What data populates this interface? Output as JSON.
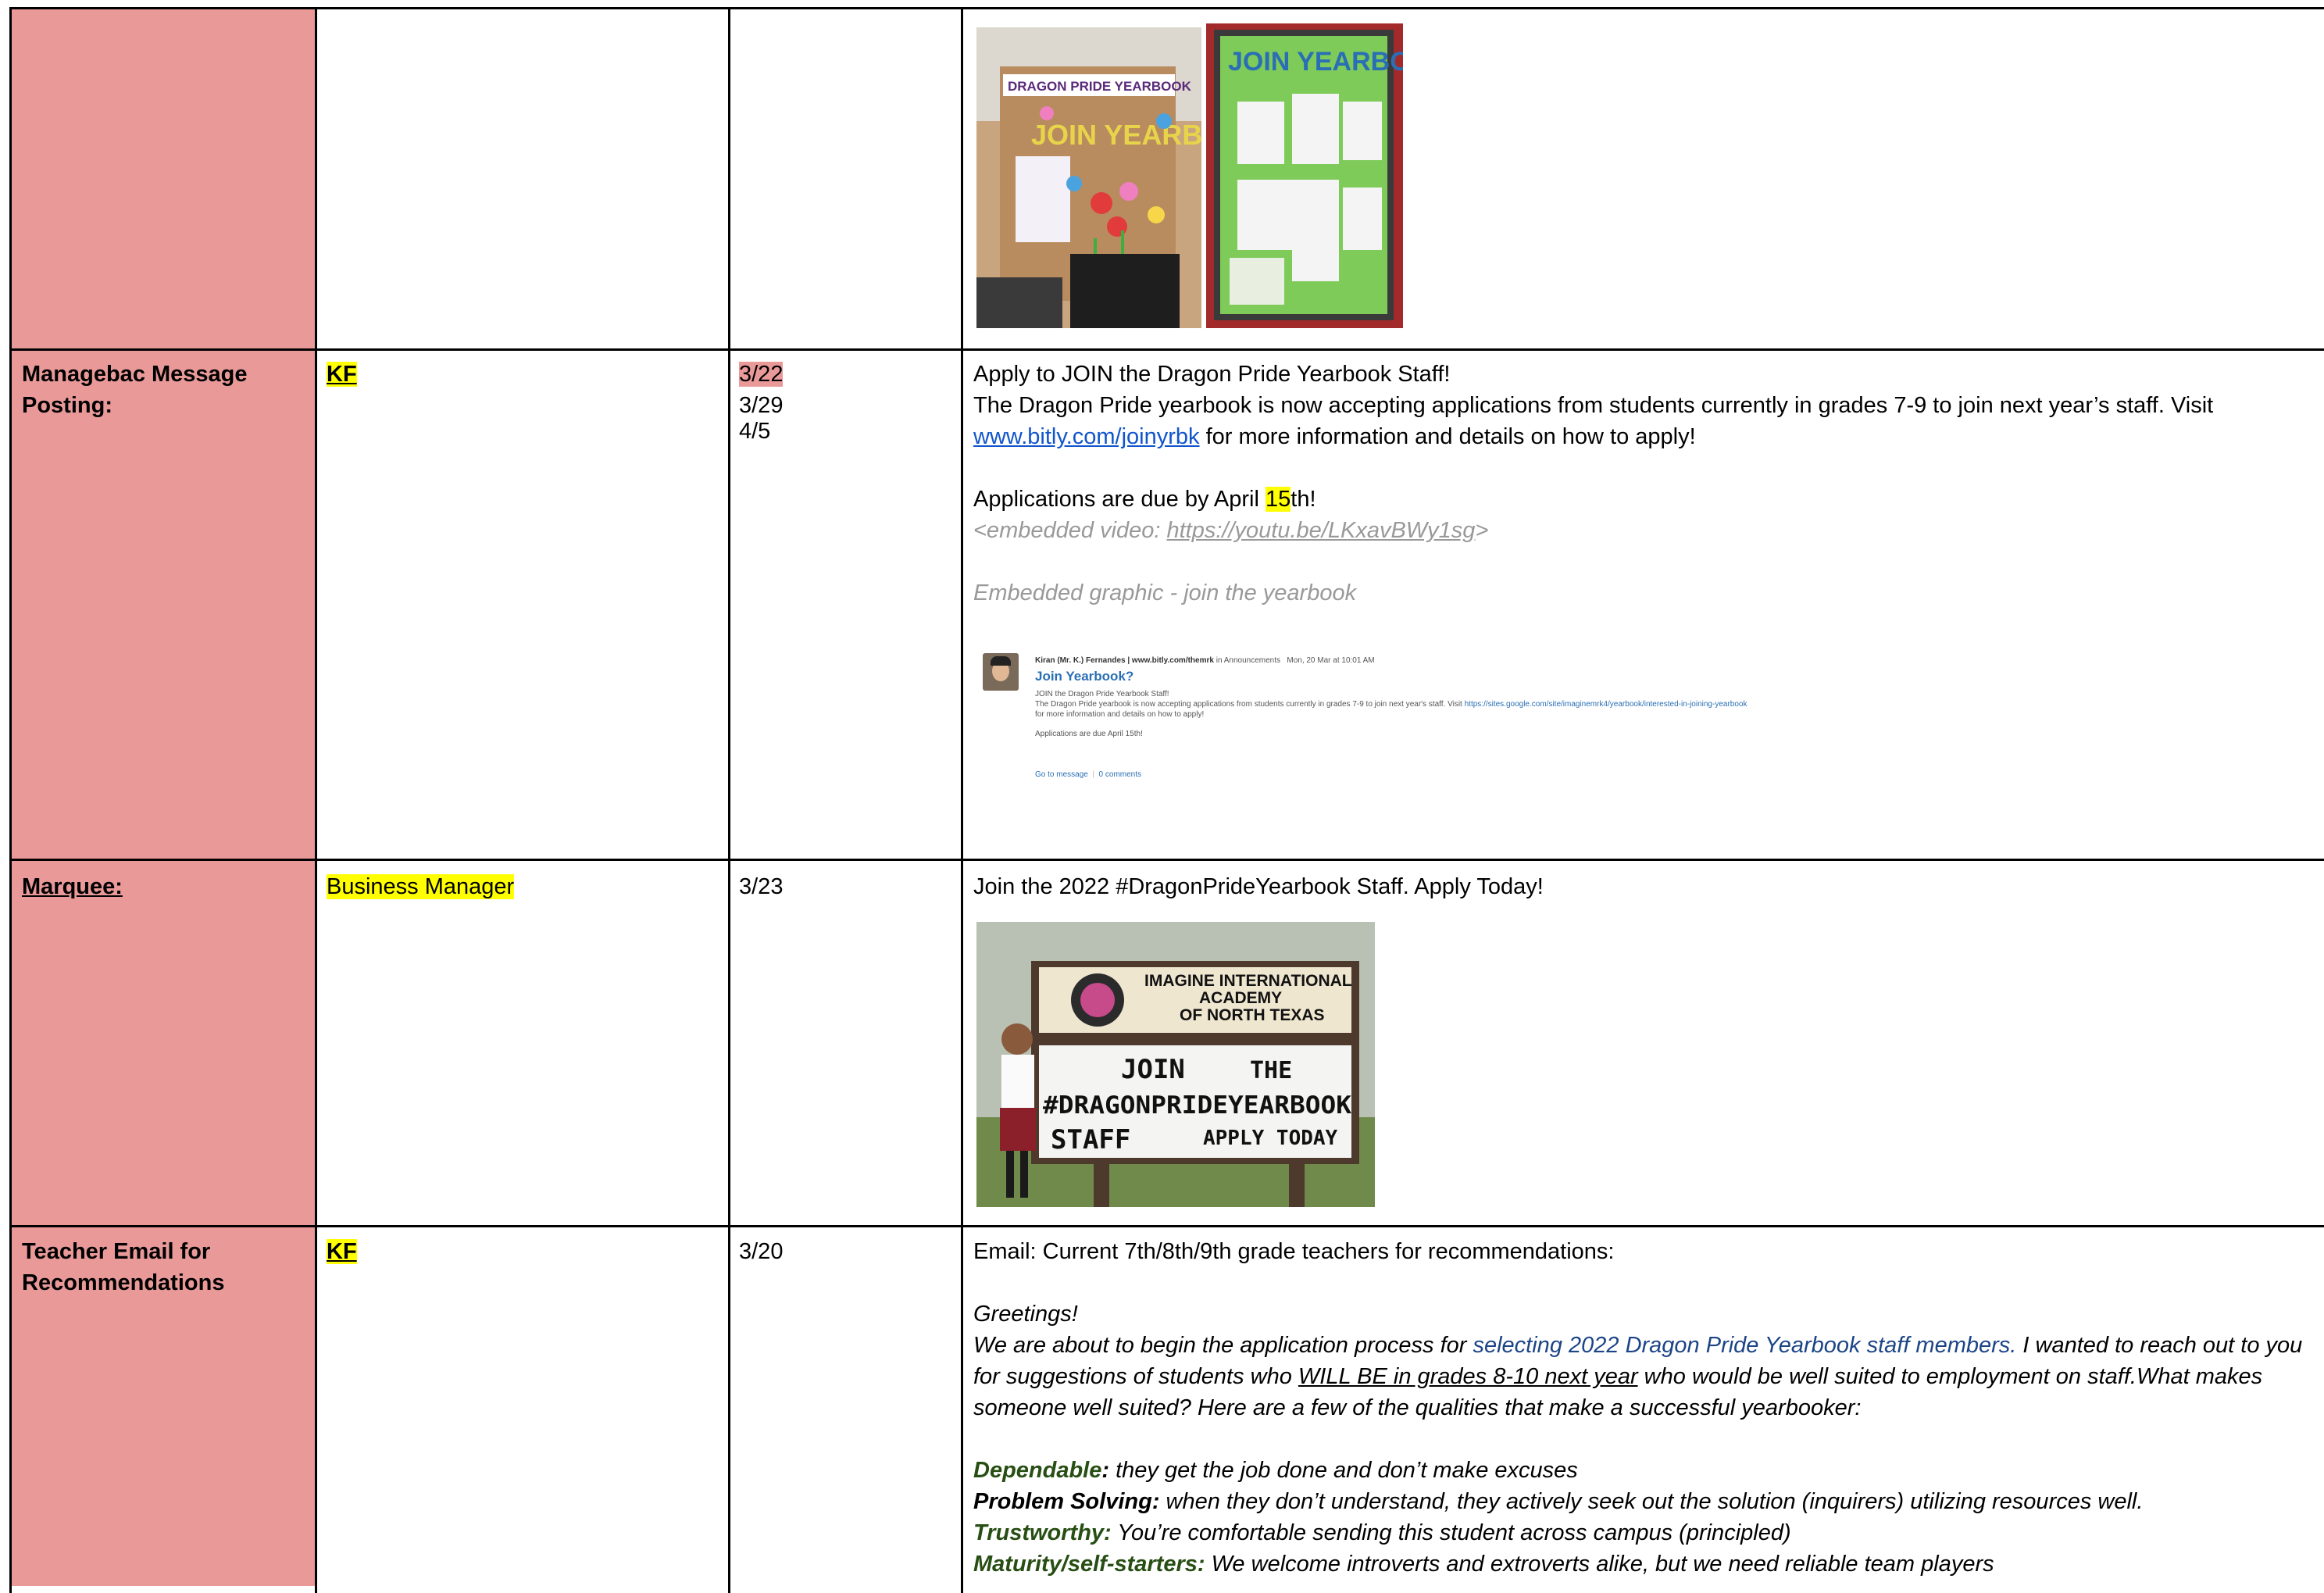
{
  "rows": {
    "r1": {
      "photo1": {
        "banner": "DRAGON PRIDE YEARBOOK",
        "letters": "JOIN YEARBOOK"
      },
      "photo2": {
        "title": "JOIN YEARBOOK"
      }
    },
    "managebac": {
      "title_line1": "Managebac Message",
      "title_line2": "Posting:",
      "person": "KF",
      "date1": "3/22",
      "date2": "3/29",
      "date3": "4/5",
      "line1": "Apply to JOIN the Dragon Pride Yearbook Staff!",
      "line2": "The Dragon Pride yearbook is now accepting applications from students currently in grades 7-9 to join next year’s staff. Visit",
      "link": "www.bitly.com/joinyrbk",
      "line3_rest": " for more information and details on how to apply!",
      "due_pre": "Applications are due by April ",
      "due_hl": "15",
      "due_post": "th!",
      "video_pre": "<embedded video: ",
      "video_link": "https://youtu.be/LKxavBWy1sg",
      "video_post": ">",
      "graphic": "Embedded graphic - join the yearbook",
      "shot": {
        "author": "Kiran (Mr. K.) Fernandes | www.bitly.com/themrk",
        "in": " in Announcements",
        "time": "Mon, 20 Mar at 10:01 AM",
        "title": "Join Yearbook?",
        "l1": "JOIN the Dragon Pride Yearbook Staff!",
        "l2": "The Dragon Pride yearbook is now accepting applications from students currently in grades 7-9 to join next year's staff. Visit",
        "l2link": "https://sites.google.com/site/imaginemrk4/yearbook/interested-in-joining-yearbook",
        "l3": "for more information and details on how to apply!",
        "l4": "Applications are due April 15th!",
        "goto": "Go to message",
        "comments": "0 comments"
      }
    },
    "marquee": {
      "title": "Marquee:",
      "person": "Business Manager",
      "date": "3/23",
      "line1": "Join the 2022 #DragonPrideYearbook Staff. Apply Today!",
      "sign_top1": "IMAGINE INTERNATIONAL",
      "sign_top2": "ACADEMY",
      "sign_top3": "OF NORTH TEXAS",
      "sign_l1a": "JOIN",
      "sign_l1b": "THE",
      "sign_l2": "#DRAGONPRIDEYEARBOOK",
      "sign_l3a": "STAFF",
      "sign_l3b": "APPLY TODAY"
    },
    "teacher": {
      "title_line1": "Teacher Email for",
      "title_line2": "Recommendations",
      "person": "KF",
      "date": "3/20",
      "line1": "Email: Current 7th/8th/9th grade teachers for recommendations:",
      "greet": "Greetings!",
      "p1a": "We are about to begin the application process for ",
      "p1b": "selecting 2022 Dragon Pride Yearbook staff members.",
      "p1c": " I wanted to reach out to you",
      "p2a": "for suggestions of students who ",
      "p2b": "WILL BE in grades 8-10 next year",
      "p2c": " who would be well suited to employment on staff.What makes",
      "p3": "someone well suited? Here are a few of the qualities that make a successful yearbooker:",
      "q1k": "Dependable",
      "q1c": ":",
      "q1t": " they get the job done and don’t make excuses",
      "q2k": "Problem Solving:",
      "q2t": " when they don’t understand, they actively seek out the solution (inquirers) utilizing resources well.",
      "q3k": "Trustworthy:",
      "q3t": " You’re comfortable sending this student across campus (principled)",
      "q4k": "Maturity/self-starters:",
      "q4t": " We welcome introverts and extroverts alike, but we need reliable team players"
    }
  },
  "colors": {
    "rowhead": "#ea9999",
    "highlight": "#ffff00",
    "link": "#1155cc",
    "green": "#274e13"
  }
}
